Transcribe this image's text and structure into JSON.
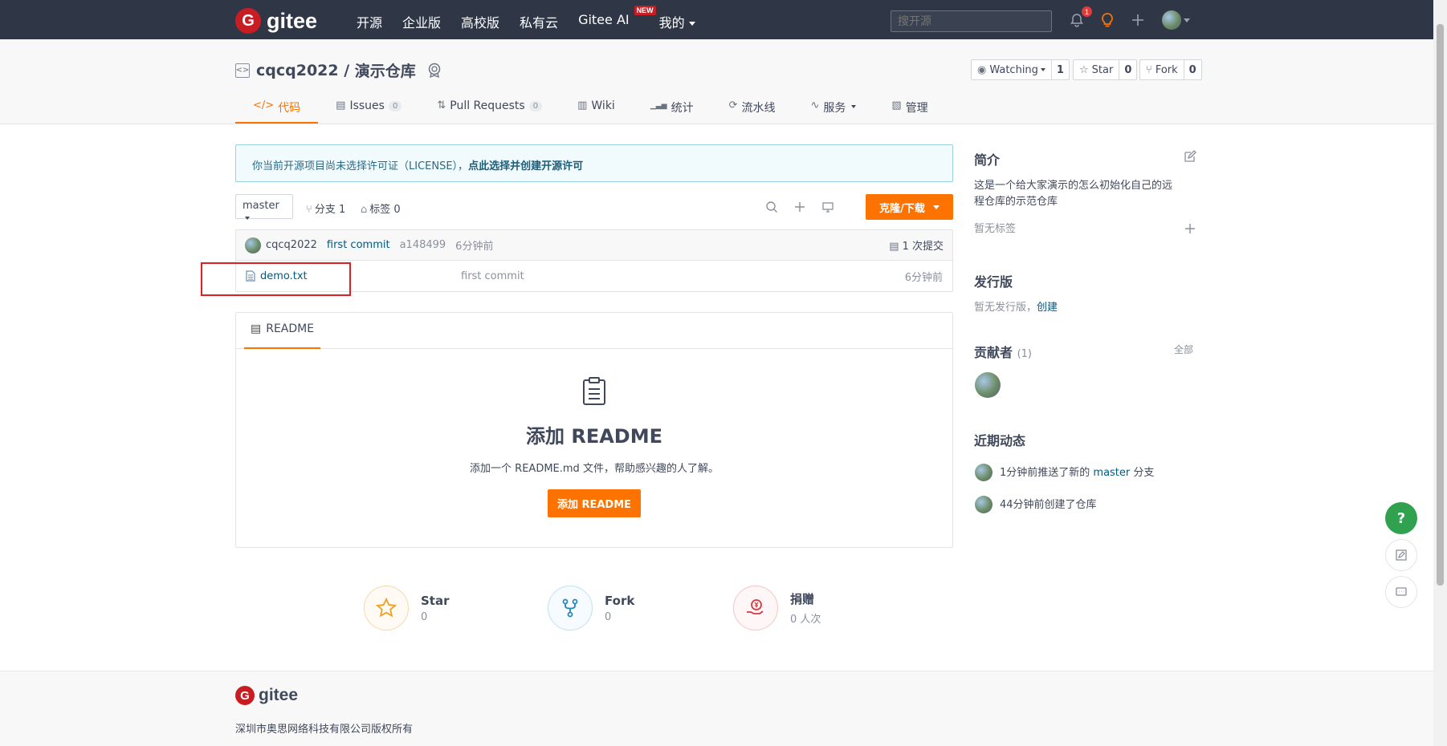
{
  "topbar": {
    "logo_mark": "G",
    "logo_text": "gitee",
    "nav": [
      {
        "label": "开源"
      },
      {
        "label": "企业版"
      },
      {
        "label": "高校版"
      },
      {
        "label": "私有云"
      },
      {
        "label": "Gitee AI",
        "badge": "NEW"
      },
      {
        "label": "我的"
      }
    ],
    "search_placeholder": "搜开源",
    "notification_count": "1"
  },
  "repo": {
    "owner": "cqcq2022",
    "separator": " / ",
    "name": "演示仓库",
    "watch": {
      "label": "Watching",
      "count": "1"
    },
    "star": {
      "label": "Star",
      "count": "0"
    },
    "fork": {
      "label": "Fork",
      "count": "0"
    }
  },
  "tabs": [
    {
      "icon": "</>",
      "label": "代码",
      "count": null
    },
    {
      "icon": "▤",
      "label": "Issues",
      "count": "0"
    },
    {
      "icon": "⇅",
      "label": "Pull Requests",
      "count": "0"
    },
    {
      "icon": "▥",
      "label": "Wiki",
      "count": null
    },
    {
      "icon": "▁▃▅",
      "label": "统计",
      "count": null
    },
    {
      "icon": "⟳",
      "label": "流水线",
      "count": null
    },
    {
      "icon": "∿",
      "label": "服务",
      "count": null
    },
    {
      "icon": "▧",
      "label": "管理",
      "count": null
    }
  ],
  "license": {
    "text": "你当前开源项目尚未选择许可证（LICENSE），",
    "link": "点此选择并创建开源许可"
  },
  "toolbar": {
    "branch": "master",
    "branches": "分支 1",
    "tags": "标签 0",
    "clone": "克隆/下载"
  },
  "commit": {
    "author": "cqcq2022",
    "message": "first commit",
    "hash": "a148499",
    "time": "6分钟前",
    "count": "1 次提交"
  },
  "files": [
    {
      "name": "demo.txt",
      "message": "first commit",
      "time": "6分钟前"
    }
  ],
  "readme": {
    "tab": "README",
    "title": "添加 README",
    "subtitle": "添加一个 README.md 文件，帮助感兴趣的人了解。",
    "button": "添加 README"
  },
  "stats": [
    {
      "name": "Star",
      "value": "0"
    },
    {
      "name": "Fork",
      "value": "0"
    },
    {
      "name": "捐赠",
      "value": "0 人次"
    }
  ],
  "sidebar": {
    "intro_title": "简介",
    "intro_text_1": "这是一个给大家演示的怎么初始化自己的远",
    "intro_text_2": "程仓库的示范仓库",
    "no_tags": "暂无标签",
    "release_title": "发行版",
    "no_release": "暂无发行版，",
    "create": "创建",
    "contributors_title": "贡献者",
    "contributors_count": "(1)",
    "all": "全部",
    "activity_title": "近期动态",
    "activity_1_pre": "1分钟前推送了新的 ",
    "activity_1_branch": "master",
    "activity_1_post": " 分支",
    "activity_2": "44分钟前创建了仓库"
  },
  "footer": {
    "logo_text": "gitee",
    "copyright": "深圳市奥思网络科技有限公司版权所有"
  },
  "colors": {
    "accent": "#fe7300",
    "topbar": "#2f3747",
    "brand": "#c71d23",
    "link": "#005980",
    "help": "#30a14e"
  }
}
